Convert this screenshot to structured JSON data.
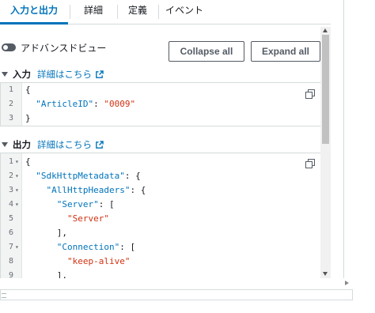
{
  "tabs": [
    {
      "label": "入力と出力",
      "active": true
    },
    {
      "label": "詳細",
      "active": false
    },
    {
      "label": "定義",
      "active": false
    },
    {
      "label": "イベント",
      "active": false
    }
  ],
  "advanced_view": {
    "label": "アドバンスドビュー",
    "enabled": false
  },
  "buttons": {
    "collapse_all": "Collapse all",
    "expand_all": "Expand all"
  },
  "input_section": {
    "title": "入力",
    "link": "詳細はこちら",
    "lines": [
      {
        "n": "1",
        "fold": "",
        "parts": [
          {
            "t": "{",
            "c": ""
          }
        ]
      },
      {
        "n": "2",
        "fold": "",
        "parts": [
          {
            "t": "  \"ArticleID\"",
            "c": "k"
          },
          {
            "t": ": ",
            "c": ""
          },
          {
            "t": "\"0009\"",
            "c": "s"
          }
        ]
      },
      {
        "n": "3",
        "fold": "",
        "parts": [
          {
            "t": "}",
            "c": ""
          }
        ]
      }
    ]
  },
  "output_section": {
    "title": "出力",
    "link": "詳細はこちら",
    "lines": [
      {
        "n": "1",
        "fold": "▾",
        "parts": [
          {
            "t": "{",
            "c": ""
          }
        ]
      },
      {
        "n": "2",
        "fold": "▾",
        "parts": [
          {
            "t": "  \"SdkHttpMetadata\"",
            "c": "k"
          },
          {
            "t": ": {",
            "c": ""
          }
        ]
      },
      {
        "n": "3",
        "fold": "▾",
        "parts": [
          {
            "t": "    \"AllHttpHeaders\"",
            "c": "k"
          },
          {
            "t": ": {",
            "c": ""
          }
        ]
      },
      {
        "n": "4",
        "fold": "▾",
        "parts": [
          {
            "t": "      \"Server\"",
            "c": "k"
          },
          {
            "t": ": [",
            "c": ""
          }
        ]
      },
      {
        "n": "5",
        "fold": "",
        "parts": [
          {
            "t": "        \"Server\"",
            "c": "s"
          }
        ]
      },
      {
        "n": "6",
        "fold": "",
        "parts": [
          {
            "t": "      ],",
            "c": ""
          }
        ]
      },
      {
        "n": "7",
        "fold": "▾",
        "parts": [
          {
            "t": "      \"Connection\"",
            "c": "k"
          },
          {
            "t": ": [",
            "c": ""
          }
        ]
      },
      {
        "n": "8",
        "fold": "",
        "parts": [
          {
            "t": "        \"keep-alive\"",
            "c": "s"
          }
        ]
      },
      {
        "n": "9",
        "fold": "",
        "parts": [
          {
            "t": "      ],",
            "c": ""
          }
        ]
      }
    ]
  },
  "icons": {
    "copy": "copy-icon",
    "external_link": "external-link-icon",
    "toggle": "toggle-icon"
  }
}
